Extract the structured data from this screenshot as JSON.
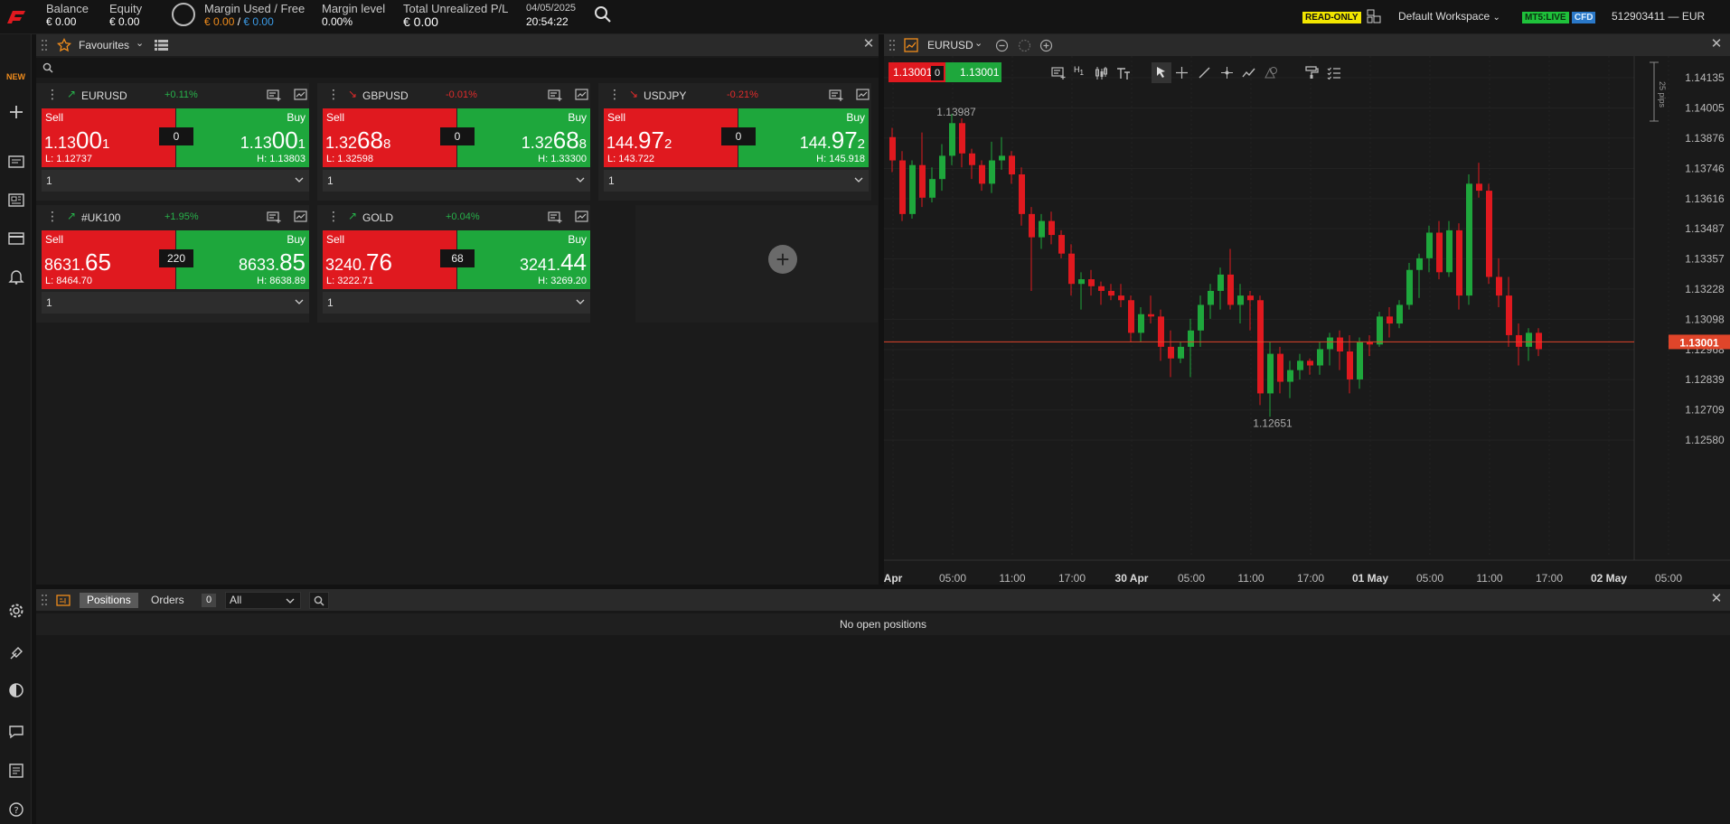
{
  "topbar": {
    "balance": {
      "label": "Balance",
      "value": "€ 0.00"
    },
    "equity": {
      "label": "Equity",
      "value": "€ 0.00"
    },
    "margin_used_free": {
      "label": "Margin Used / Free",
      "used": "€ 0.00",
      "sep": " / ",
      "free": "€ 0.00"
    },
    "margin_level": {
      "label": "Margin level",
      "value": "0.00%"
    },
    "unrealized": {
      "label": "Total Unrealized P/L",
      "value": "€ 0.00"
    },
    "date": "04/05/2025",
    "time": "20:54:22",
    "read_only": "READ-ONLY",
    "workspace": "Default Workspace",
    "mt5": "MT5:LIVE",
    "cfd": "CFD",
    "account": "512903411 — EUR"
  },
  "left_nav": {
    "new_label": "NEW"
  },
  "favourites": {
    "title": "Favourites",
    "tiles": [
      {
        "symbol": "EURUSD",
        "change": "+0.11%",
        "sell_label": "Sell",
        "buy_label": "Buy",
        "sell": {
          "a": "1.13",
          "b": "00",
          "c": "1"
        },
        "buy": {
          "a": "1.13",
          "b": "00",
          "c": "1"
        },
        "spread": "0",
        "low": "L: 1.12737",
        "high": "H: 1.13803",
        "qty": "1"
      },
      {
        "symbol": "GBPUSD",
        "change": "-0.01%",
        "sell_label": "Sell",
        "buy_label": "Buy",
        "sell": {
          "a": "1.32",
          "b": "68",
          "c": "8"
        },
        "buy": {
          "a": "1.32",
          "b": "68",
          "c": "8"
        },
        "spread": "0",
        "low": "L: 1.32598",
        "high": "H: 1.33300",
        "qty": "1"
      },
      {
        "symbol": "USDJPY",
        "change": "-0.21%",
        "sell_label": "Sell",
        "buy_label": "Buy",
        "sell": {
          "a": "144.",
          "b": "97",
          "c": "2"
        },
        "buy": {
          "a": "144.",
          "b": "97",
          "c": "2"
        },
        "spread": "0",
        "low": "L: 143.722",
        "high": "H: 145.918",
        "qty": "1"
      },
      {
        "symbol": "#UK100",
        "change": "+1.95%",
        "sell_label": "Sell",
        "buy_label": "Buy",
        "sell": {
          "a": "8631.",
          "b": "65",
          "c": ""
        },
        "buy": {
          "a": "8633.",
          "b": "85",
          "c": ""
        },
        "spread": "220",
        "low": "L: 8464.70",
        "high": "H: 8638.89",
        "qty": "1"
      },
      {
        "symbol": "GOLD",
        "change": "+0.04%",
        "sell_label": "Sell",
        "buy_label": "Buy",
        "sell": {
          "a": "3240.",
          "b": "76",
          "c": ""
        },
        "buy": {
          "a": "3241.",
          "b": "44",
          "c": ""
        },
        "spread": "68",
        "low": "L: 3222.71",
        "high": "H: 3269.20",
        "qty": "1"
      }
    ]
  },
  "chart": {
    "symbol": "EURUSD",
    "sell_price": "1.13001",
    "spread": "0",
    "buy_price": "1.13001",
    "timeframe": "H",
    "timeframe_sub": "1",
    "pips_label": "25 pips",
    "current_price": "1.13001",
    "high_annotation": "1.13987",
    "low_annotation": "1.12651",
    "colors": {
      "up": "#1ea73c",
      "down": "#e0191f"
    }
  },
  "chart_data": {
    "type": "candlestick",
    "title": "",
    "y_ticks": [
      1.14135,
      1.14005,
      1.13876,
      1.13746,
      1.13616,
      1.13487,
      1.13357,
      1.13228,
      1.13098,
      1.12968,
      1.12839,
      1.12709,
      1.1258
    ],
    "y_tick_labels": [
      "1.14135",
      "1.14005",
      "1.13876",
      "1.13746",
      "1.13616",
      "1.13487",
      "1.13357",
      "1.13228",
      "1.13098",
      "1.12968",
      "1.12839",
      "1.12709",
      "1.12580"
    ],
    "x_tick_labels": [
      "Apr",
      "05:00",
      "11:00",
      "17:00",
      "30 Apr",
      "05:00",
      "11:00",
      "17:00",
      "01 May",
      "05:00",
      "11:00",
      "17:00",
      "02 May",
      "05:00"
    ],
    "x_tick_bold": [
      true,
      false,
      false,
      false,
      true,
      false,
      false,
      false,
      true,
      false,
      false,
      false,
      true,
      false
    ],
    "ylim": [
      1.125,
      1.1425
    ],
    "last_price": 1.13001,
    "candles": [
      [
        1.1388,
        1.1392,
        1.1373,
        1.1378
      ],
      [
        1.1378,
        1.1382,
        1.1352,
        1.1355
      ],
      [
        1.1355,
        1.1378,
        1.1353,
        1.1376
      ],
      [
        1.1376,
        1.139,
        1.1358,
        1.1362
      ],
      [
        1.1362,
        1.1375,
        1.136,
        1.137
      ],
      [
        1.137,
        1.1385,
        1.1365,
        1.138
      ],
      [
        1.138,
        1.1398,
        1.1376,
        1.1394
      ],
      [
        1.1394,
        1.1396,
        1.1375,
        1.1381
      ],
      [
        1.1381,
        1.1383,
        1.137,
        1.1376
      ],
      [
        1.1376,
        1.1378,
        1.1365,
        1.1368
      ],
      [
        1.1368,
        1.1386,
        1.1364,
        1.1378
      ],
      [
        1.1378,
        1.1388,
        1.1374,
        1.138
      ],
      [
        1.138,
        1.1382,
        1.1368,
        1.1372
      ],
      [
        1.1372,
        1.1375,
        1.135,
        1.1355
      ],
      [
        1.1355,
        1.1358,
        1.1322,
        1.1345
      ],
      [
        1.1345,
        1.1355,
        1.134,
        1.1352
      ],
      [
        1.1352,
        1.1356,
        1.1342,
        1.1346
      ],
      [
        1.1346,
        1.1348,
        1.1336,
        1.1338
      ],
      [
        1.1338,
        1.1342,
        1.132,
        1.1325
      ],
      [
        1.1325,
        1.133,
        1.1314,
        1.1327
      ],
      [
        1.1327,
        1.1331,
        1.132,
        1.1324
      ],
      [
        1.1324,
        1.1326,
        1.1316,
        1.1322
      ],
      [
        1.1322,
        1.1325,
        1.1318,
        1.132
      ],
      [
        1.132,
        1.1325,
        1.1315,
        1.1318
      ],
      [
        1.1318,
        1.132,
        1.13,
        1.1304
      ],
      [
        1.1304,
        1.1315,
        1.13,
        1.1312
      ],
      [
        1.1312,
        1.132,
        1.1308,
        1.1311
      ],
      [
        1.1311,
        1.1314,
        1.1292,
        1.1298
      ],
      [
        1.1298,
        1.1305,
        1.1285,
        1.1293
      ],
      [
        1.1293,
        1.13,
        1.1291,
        1.1298
      ],
      [
        1.1298,
        1.131,
        1.1285,
        1.1305
      ],
      [
        1.1305,
        1.132,
        1.1298,
        1.1316
      ],
      [
        1.1316,
        1.1325,
        1.131,
        1.1322
      ],
      [
        1.1322,
        1.1332,
        1.1314,
        1.1329
      ],
      [
        1.1329,
        1.134,
        1.1314,
        1.1316
      ],
      [
        1.1316,
        1.1325,
        1.1308,
        1.132
      ],
      [
        1.132,
        1.1322,
        1.1305,
        1.1318
      ],
      [
        1.1318,
        1.132,
        1.1273,
        1.1278
      ],
      [
        1.1278,
        1.13,
        1.1268,
        1.1295
      ],
      [
        1.1295,
        1.1298,
        1.1278,
        1.1283
      ],
      [
        1.1283,
        1.1292,
        1.1276,
        1.1288
      ],
      [
        1.1288,
        1.1295,
        1.1284,
        1.1292
      ],
      [
        1.1292,
        1.1293,
        1.1286,
        1.129
      ],
      [
        1.129,
        1.13,
        1.1286,
        1.1297
      ],
      [
        1.1297,
        1.1304,
        1.129,
        1.1302
      ],
      [
        1.1302,
        1.1305,
        1.1288,
        1.1296
      ],
      [
        1.1296,
        1.1303,
        1.1278,
        1.1284
      ],
      [
        1.1284,
        1.1302,
        1.128,
        1.13
      ],
      [
        1.13,
        1.1303,
        1.1294,
        1.1299
      ],
      [
        1.1299,
        1.1313,
        1.1298,
        1.1311
      ],
      [
        1.1311,
        1.1315,
        1.1302,
        1.1308
      ],
      [
        1.1308,
        1.1318,
        1.1306,
        1.1316
      ],
      [
        1.1316,
        1.1334,
        1.1314,
        1.1331
      ],
      [
        1.1331,
        1.1338,
        1.1319,
        1.1336
      ],
      [
        1.1336,
        1.135,
        1.133,
        1.1347
      ],
      [
        1.1347,
        1.1352,
        1.1327,
        1.133
      ],
      [
        1.133,
        1.1352,
        1.1328,
        1.1348
      ],
      [
        1.1348,
        1.1351,
        1.1314,
        1.132
      ],
      [
        1.132,
        1.1372,
        1.1316,
        1.1368
      ],
      [
        1.1368,
        1.1377,
        1.1362,
        1.1365
      ],
      [
        1.1365,
        1.1368,
        1.1325,
        1.1328
      ],
      [
        1.1328,
        1.1336,
        1.1315,
        1.132
      ],
      [
        1.132,
        1.1328,
        1.1298,
        1.1303
      ],
      [
        1.1303,
        1.1308,
        1.129,
        1.1298
      ],
      [
        1.1298,
        1.1306,
        1.1292,
        1.1304
      ],
      [
        1.1304,
        1.1306,
        1.1294,
        1.1297
      ]
    ]
  },
  "positions": {
    "tab_positions": "Positions",
    "tab_orders": "Orders",
    "count": "0",
    "filter": "All",
    "empty": "No open positions"
  }
}
